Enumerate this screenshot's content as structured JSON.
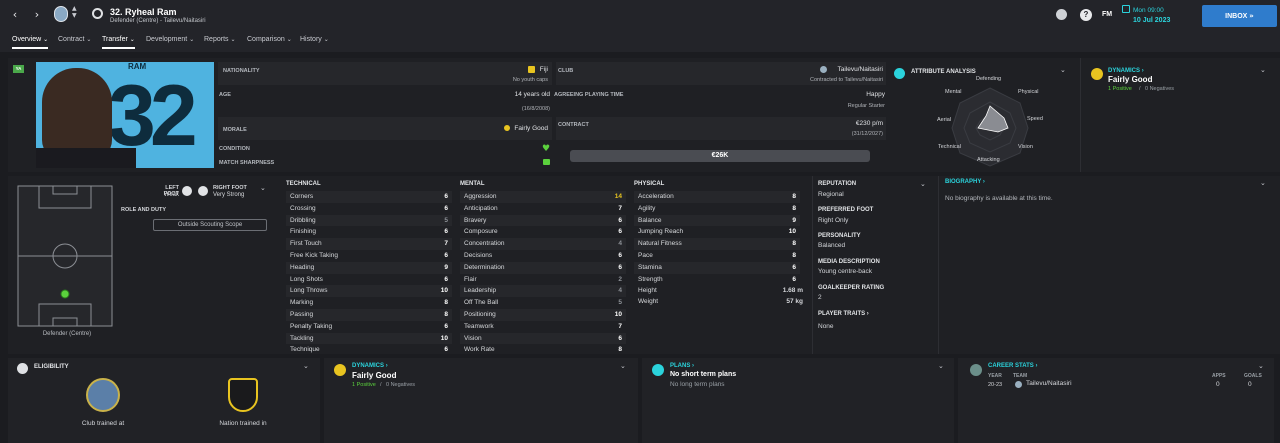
{
  "header": {
    "back": "‹",
    "forward": "›",
    "player_title": "32. Ryheal Ram",
    "player_sub": "Defender (Centre) - Tailevu/Naitasiri",
    "date_time": "Mon 09:00",
    "date": "10 Jul 2023",
    "fm": "FM",
    "inbox": "INBOX"
  },
  "tabs": [
    "Overview",
    "Contract",
    "Transfer",
    "Development",
    "Reports",
    "Comparison",
    "History"
  ],
  "profile": {
    "position_badge": "YA",
    "shirt_name": "RAM",
    "shirt_number": "32"
  },
  "info": {
    "nationality_label": "NATIONALITY",
    "nationality": "Fiji",
    "youth_caps": "No youth caps",
    "club_label": "CLUB",
    "club": "Tailevu/Naitasiri",
    "contracted": "Contracted to Tailevu/Naitasiri",
    "age_label": "AGE",
    "age": "14 years old",
    "dob": "(16/8/2008)",
    "apt_label": "AGREEING PLAYING TIME",
    "happiness": "Happy",
    "playing_time": "Regular Starter",
    "morale_label": "MORALE",
    "morale": "Fairly Good",
    "contract_label": "CONTRACT",
    "wage": "€230 p/m",
    "expiry": "(31/12/2027)",
    "condition_label": "CONDITION",
    "sharpness_label": "MATCH SHARPNESS",
    "value": "€26K"
  },
  "attr_analysis": {
    "title": "ATTRIBUTE ANALYSIS",
    "labels": [
      "Defending",
      "Physical",
      "Speed",
      "Vision",
      "Attacking",
      "Technical",
      "Aerial",
      "Mental"
    ]
  },
  "dynamics": {
    "title": "DYNAMICS",
    "value": "Fairly Good",
    "positives": "1 Positive",
    "negatives": "0 Negatives",
    "sep": "/"
  },
  "pitch": {
    "position": "Defender (Centre)",
    "left_foot_label": "LEFT FOOT",
    "left_foot": "Weak",
    "right_foot_label": "RIGHT FOOT",
    "right_foot": "Very Strong",
    "role_label": "ROLE AND DUTY",
    "role_button": "Outside Scouting Scope"
  },
  "technical": {
    "title": "TECHNICAL",
    "items": [
      [
        "Corners",
        "6"
      ],
      [
        "Crossing",
        "6"
      ],
      [
        "Dribbling",
        "5"
      ],
      [
        "Finishing",
        "6"
      ],
      [
        "First Touch",
        "7"
      ],
      [
        "Free Kick Taking",
        "6"
      ],
      [
        "Heading",
        "9"
      ],
      [
        "Long Shots",
        "6"
      ],
      [
        "Long Throws",
        "10"
      ],
      [
        "Marking",
        "8"
      ],
      [
        "Passing",
        "8"
      ],
      [
        "Penalty Taking",
        "6"
      ],
      [
        "Tackling",
        "10"
      ],
      [
        "Technique",
        "6"
      ]
    ]
  },
  "mental": {
    "title": "MENTAL",
    "items": [
      [
        "Aggression",
        "14"
      ],
      [
        "Anticipation",
        "7"
      ],
      [
        "Bravery",
        "6"
      ],
      [
        "Composure",
        "6"
      ],
      [
        "Concentration",
        "4"
      ],
      [
        "Decisions",
        "6"
      ],
      [
        "Determination",
        "6"
      ],
      [
        "Flair",
        "2"
      ],
      [
        "Leadership",
        "4"
      ],
      [
        "Off The Ball",
        "5"
      ],
      [
        "Positioning",
        "10"
      ],
      [
        "Teamwork",
        "7"
      ],
      [
        "Vision",
        "6"
      ],
      [
        "Work Rate",
        "8"
      ]
    ]
  },
  "physical": {
    "title": "PHYSICAL",
    "items": [
      [
        "Acceleration",
        "8"
      ],
      [
        "Agility",
        "8"
      ],
      [
        "Balance",
        "9"
      ],
      [
        "Jumping Reach",
        "10"
      ],
      [
        "Natural Fitness",
        "8"
      ],
      [
        "Pace",
        "8"
      ],
      [
        "Stamina",
        "6"
      ],
      [
        "Strength",
        "6"
      ]
    ],
    "height_label": "Height",
    "height": "1.68 m",
    "weight_label": "Weight",
    "weight": "57 kg"
  },
  "right_panel": {
    "reputation_label": "REPUTATION",
    "reputation": "Regional",
    "foot_label": "PREFERRED FOOT",
    "foot": "Right Only",
    "personality_label": "PERSONALITY",
    "personality": "Balanced",
    "media_label": "MEDIA DESCRIPTION",
    "media": "Young centre-back",
    "gk_label": "GOALKEEPER RATING",
    "gk": "2",
    "traits_label": "PLAYER TRAITS",
    "traits": "None"
  },
  "biography": {
    "title": "BIOGRAPHY",
    "text": "No biography is available at this time."
  },
  "eligibility": {
    "title": "ELIGIBILITY",
    "club_trained": "Club trained at",
    "nation_trained": "Nation trained in"
  },
  "plans": {
    "title": "PLANS",
    "short": "No short term plans",
    "long": "No long term plans"
  },
  "career": {
    "title": "CAREER STATS",
    "year_h": "YEAR",
    "team_h": "TEAM",
    "apps_h": "APPS",
    "goals_h": "GOALS",
    "year": "20-23",
    "team": "Tailevu/Naitasiri",
    "apps": "0",
    "goals": "0"
  },
  "colors": {
    "accent_cyan": "#2bd3dc",
    "positive": "#5bd13d",
    "morale_yellow": "#e8c420",
    "inbox_blue": "#2f7ccc",
    "shirt_blue": "#4fb3e0"
  }
}
